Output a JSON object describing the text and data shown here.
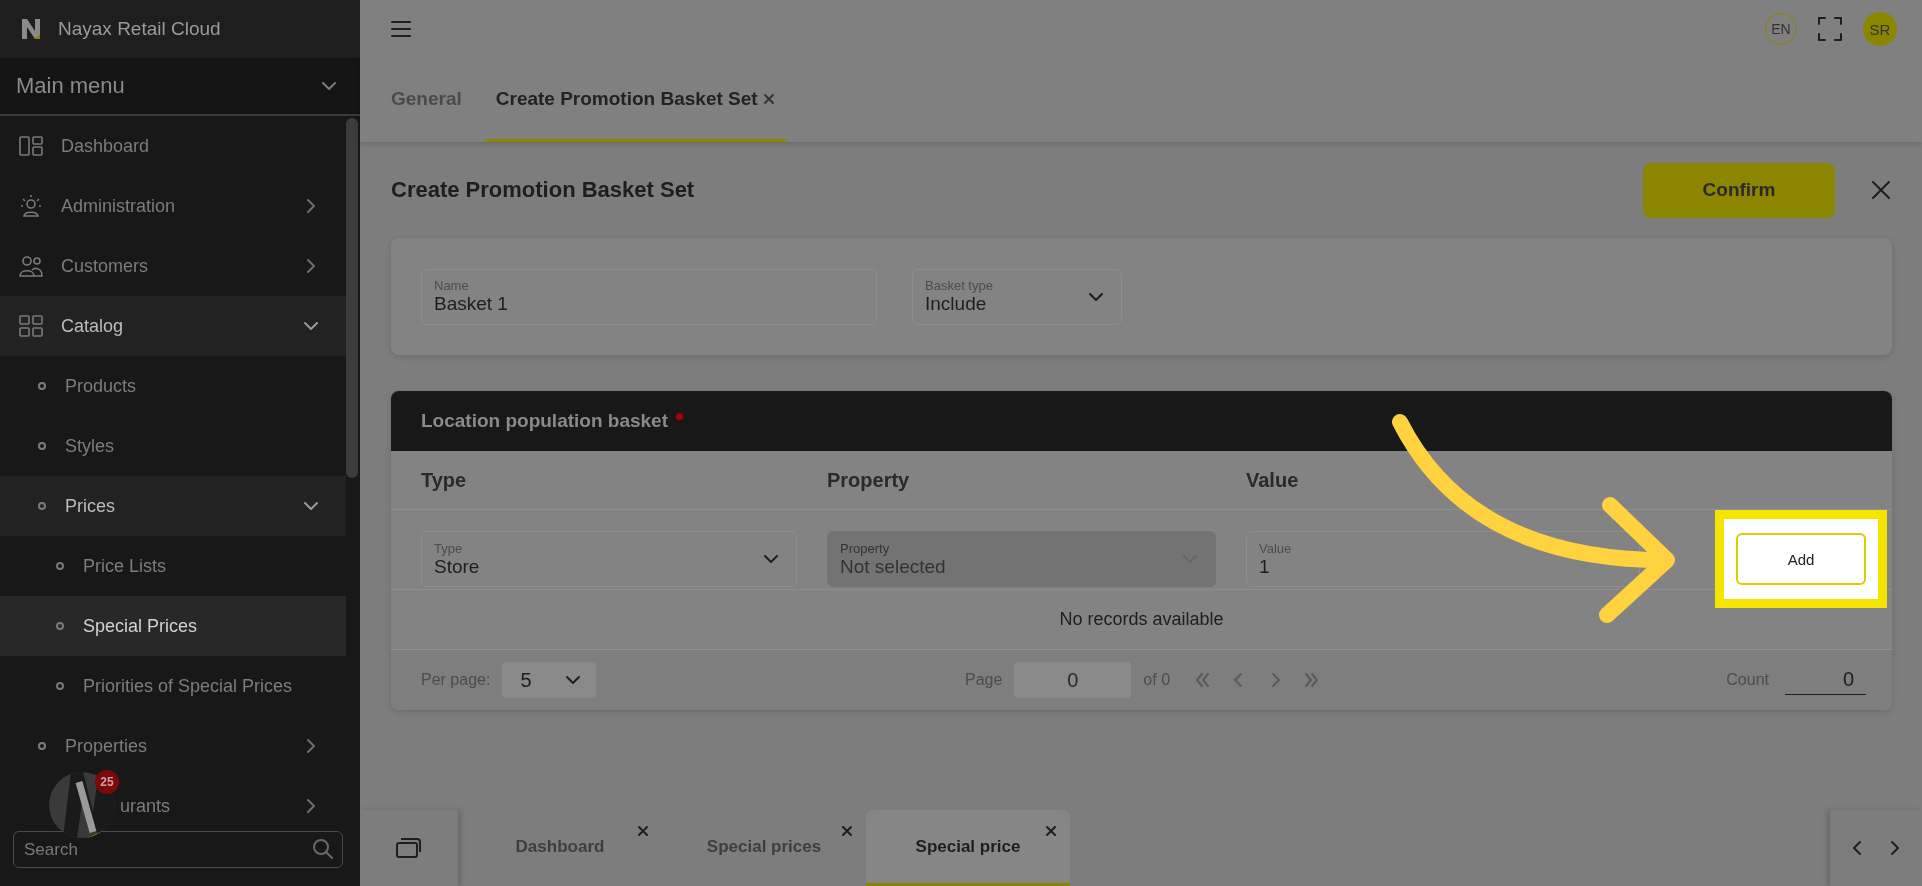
{
  "app": {
    "title": "Nayax Retail Cloud",
    "main_menu": "Main menu",
    "search": {
      "placeholder": "Search"
    },
    "notification_count": "25"
  },
  "sidebar": {
    "items": [
      {
        "label": "Dashboard",
        "selected": false
      },
      {
        "label": "Administration",
        "selected": false,
        "expanded": false
      },
      {
        "label": "Customers",
        "selected": false,
        "expanded": false
      },
      {
        "label": "Catalog",
        "selected": false,
        "expanded": true,
        "children": [
          {
            "label": "Products",
            "selected": false
          },
          {
            "label": "Styles",
            "selected": false
          },
          {
            "label": "Prices",
            "selected": false,
            "expanded": true,
            "children": [
              {
                "label": "Price Lists",
                "selected": false
              },
              {
                "label": "Special Prices",
                "selected": true
              },
              {
                "label": "Priorities of Special Prices",
                "selected": false
              }
            ]
          },
          {
            "label": "Properties",
            "selected": false,
            "expanded": false
          },
          {
            "label": "urants",
            "selected": false,
            "expanded": false,
            "covered": true
          }
        ]
      }
    ]
  },
  "topbar": {
    "language": "EN",
    "user_initials": "SR"
  },
  "tabs": [
    {
      "label": "General",
      "selected": false,
      "closable": false
    },
    {
      "label": "Create Promotion Basket Set",
      "selected": true,
      "closable": true
    }
  ],
  "page": {
    "title": "Create Promotion Basket Set",
    "confirm": "Confirm",
    "fields": [
      {
        "kind": "text",
        "label": "Name",
        "value": "Basket 1"
      },
      {
        "kind": "select",
        "label": "Basket type",
        "value": "Include"
      }
    ],
    "section": {
      "title": "Location population basket",
      "required": true,
      "columns": [
        "Type",
        "Property",
        "Value"
      ],
      "filters": [
        {
          "kind": "select",
          "label": "Type",
          "value": "Store",
          "disabled": false
        },
        {
          "kind": "select",
          "label": "Property",
          "value": "Not selected",
          "disabled": true
        },
        {
          "kind": "text",
          "label": "Value",
          "value": "1",
          "disabled": false
        }
      ],
      "add_button": "Add",
      "highlighted": true,
      "empty_message": "No records available",
      "pager": {
        "per_page_label": "Per page:",
        "per_page": "5",
        "page_label": "Page",
        "page": "0",
        "of": "of 0",
        "count_label": "Count",
        "count": "0"
      }
    }
  },
  "bottom_tabs": [
    {
      "label": "Dashboard",
      "selected": false
    },
    {
      "label": "Special prices",
      "selected": false
    },
    {
      "label": "Special price",
      "selected": true
    }
  ]
}
